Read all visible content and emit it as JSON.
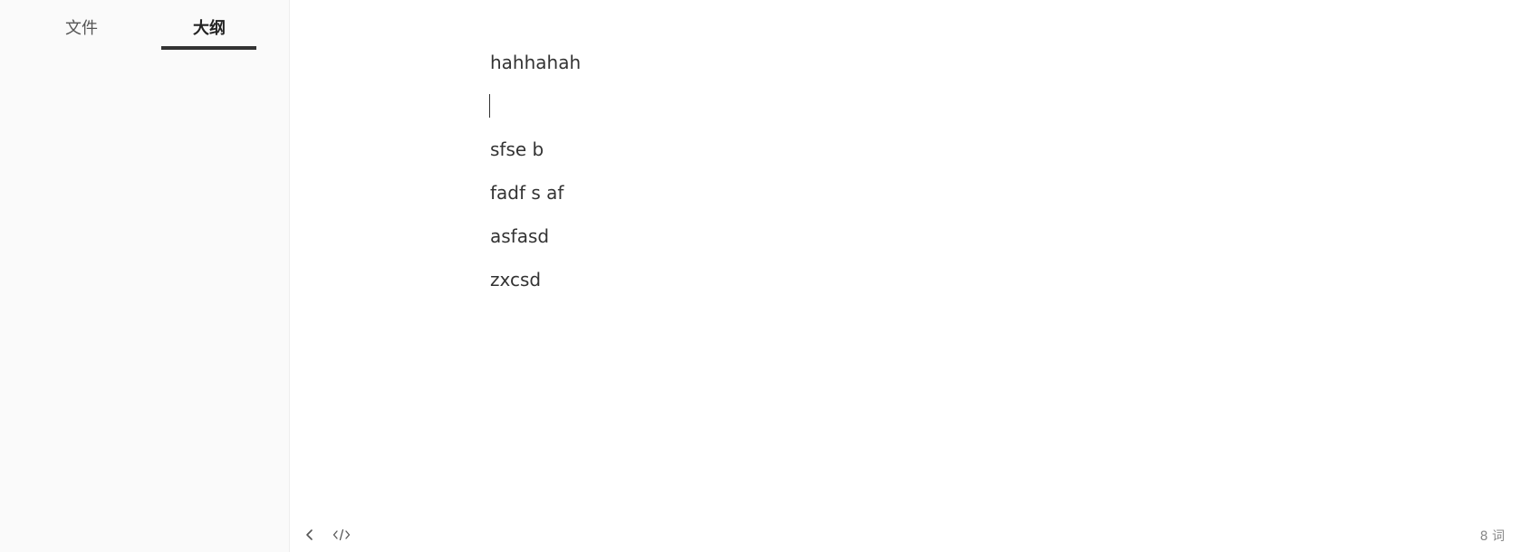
{
  "sidebar": {
    "tabs": [
      {
        "label": "文件",
        "active": false
      },
      {
        "label": "大纲",
        "active": true
      }
    ]
  },
  "editor": {
    "paragraphs": [
      "hahhahah",
      "",
      "sfse b",
      "fadf s af",
      "asfasd",
      "zxcsd"
    ]
  },
  "bottom_bar": {
    "back_icon": "chevron-left-icon",
    "source_icon": "code-icon",
    "word_count": "8 词"
  },
  "colors": {
    "sidebar_bg": "#fafafa",
    "text": "#333333",
    "active_underline": "#333333"
  }
}
